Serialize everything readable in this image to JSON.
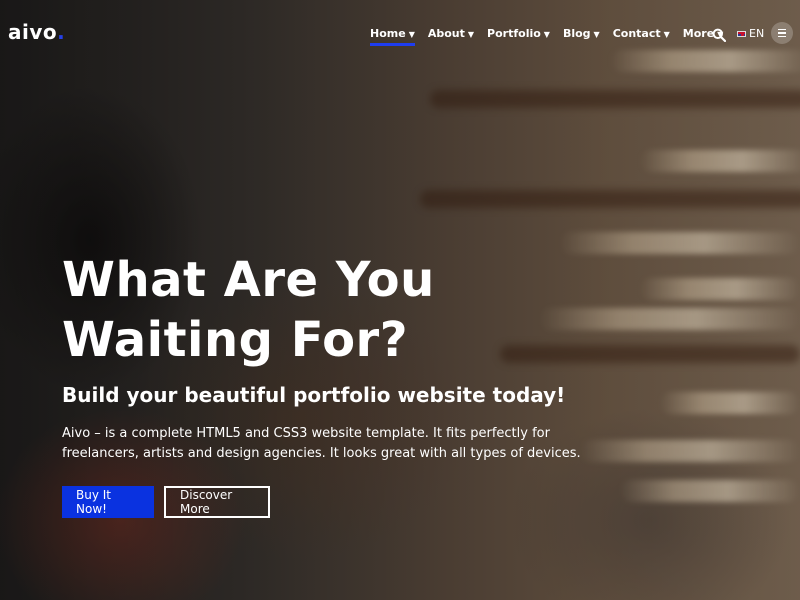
{
  "brand": {
    "logo_text": "aivo",
    "logo_dot": ".",
    "accent_color": "#0a32e0"
  },
  "nav": {
    "items": [
      {
        "label": "Home",
        "active": true
      },
      {
        "label": "About",
        "active": false
      },
      {
        "label": "Portfolio",
        "active": false
      },
      {
        "label": "Blog",
        "active": false
      },
      {
        "label": "Contact",
        "active": false
      },
      {
        "label": "More",
        "active": false
      }
    ],
    "search_icon": "search-icon",
    "language": {
      "flag": "uk-flag-icon",
      "code": "EN"
    },
    "menu_icon": "hamburger-icon"
  },
  "hero": {
    "title_line1": "What Are You",
    "title_line2": "Waiting For?",
    "subtitle": "Build your beautiful portfolio website today!",
    "description": "Aivo – is a complete HTML5 and CSS3 website template. It fits perfectly for freelancers, artists and design agencies. It looks great with all types of devices.",
    "primary_button": "Buy It Now!",
    "secondary_button": "Discover More"
  }
}
